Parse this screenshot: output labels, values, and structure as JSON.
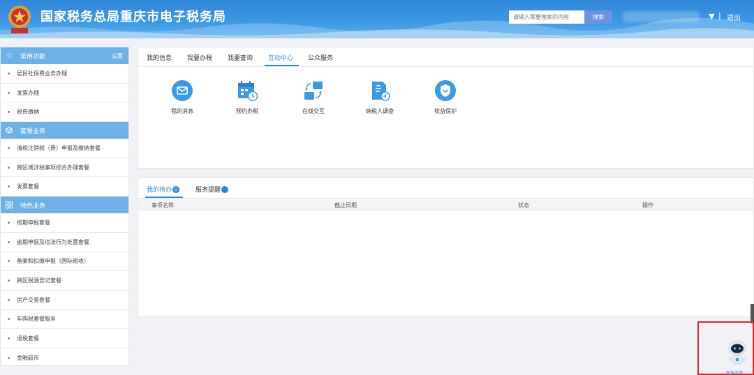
{
  "header": {
    "site_title": "国家税务总局重庆市电子税务局",
    "search_placeholder": "请输入需要搜索的内容",
    "search_button": "搜索",
    "dropdown_arrow": "▼",
    "separator": "|",
    "logout": "退出"
  },
  "sidebar": {
    "sections": [
      {
        "title": "常用功能",
        "icon": "star-icon",
        "right_label": "设置",
        "items": [
          "居民社保费业务办理",
          "发票办理",
          "税费缴纳"
        ]
      },
      {
        "title": "套餐业务",
        "icon": "cube-icon",
        "right_label": "",
        "items": [
          "清税注销税（费）申报及缴纳套餐",
          "跨区域涉税事项综合办理套餐",
          "发票套餐"
        ]
      },
      {
        "title": "特色业务",
        "icon": "grid-icon",
        "right_label": "",
        "items": [
          "按期申报套餐",
          "逾期申报及违法行为处置套餐",
          "备案和扣缴申报（国际税收）",
          "跨区税源登记套餐",
          "房产交易套餐",
          "车购税套餐服务",
          "退税套餐",
          "金融超市"
        ]
      }
    ]
  },
  "main": {
    "tabs": [
      "我的信息",
      "我要办税",
      "我要查询",
      "互动中心",
      "公众服务"
    ],
    "active_tab": "互动中心",
    "services": [
      {
        "label": "我的消息",
        "icon": "envelope-icon"
      },
      {
        "label": "预约办税",
        "icon": "calendar-clock-icon"
      },
      {
        "label": "在线交互",
        "icon": "exchange-icon"
      },
      {
        "label": "纳税人调查",
        "icon": "survey-icon"
      },
      {
        "label": "权益保护",
        "icon": "shield-icon"
      }
    ],
    "bottom_tabs": [
      {
        "label": "我的待办",
        "count": "0"
      },
      {
        "label": "服务提醒",
        "count": ""
      }
    ],
    "table_headers": [
      "事项名称",
      "截止日期",
      "状态",
      "操作"
    ]
  },
  "assistant": {
    "label": "在线咨询",
    "icon": "robot-icon"
  },
  "colors": {
    "primary": "#2f86d8",
    "section_bar": "#6eb1e8",
    "highlight_box": "#e3262e"
  }
}
